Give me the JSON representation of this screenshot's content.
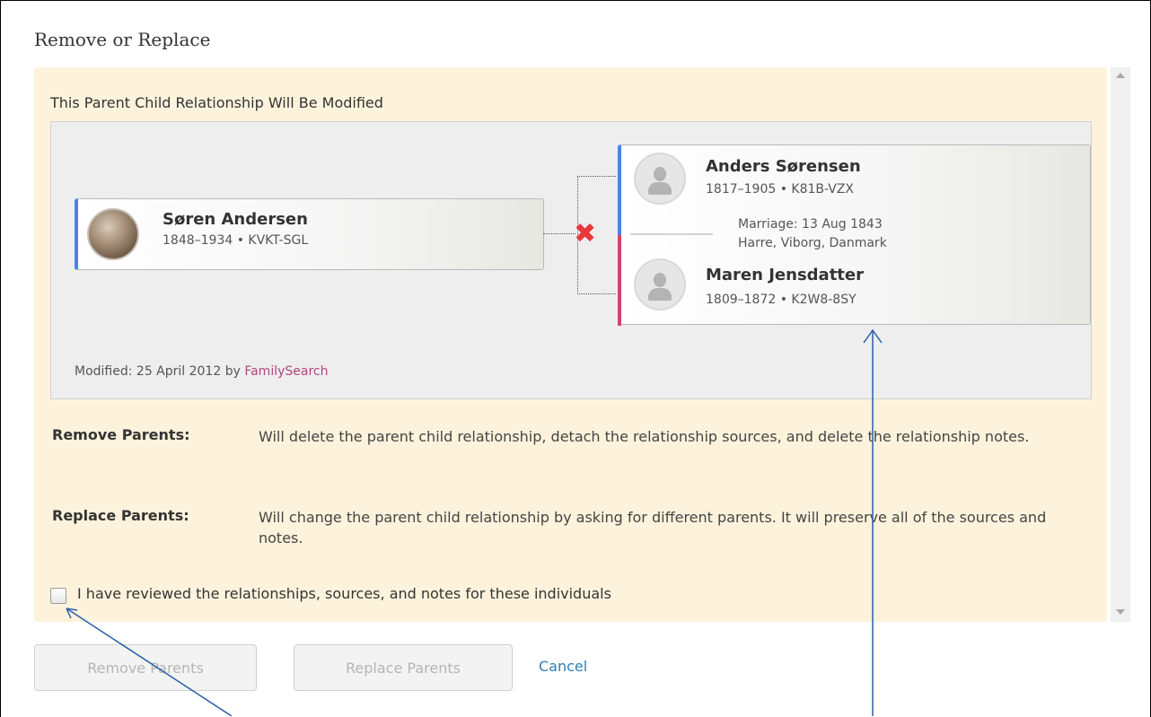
{
  "dialog": {
    "title": "Remove or Replace"
  },
  "panel": {
    "title": "This Parent Child Relationship Will Be Modified",
    "child": {
      "name": "Søren Andersen",
      "meta": "1848–1934 • KVKT-SGL"
    },
    "father": {
      "name": "Anders Sørensen",
      "meta": "1817–1905 • K81B-VZX"
    },
    "mother": {
      "name": "Maren Jensdatter",
      "meta": "1809–1872 • K2W8-8SY"
    },
    "marriage": {
      "line1": "Marriage: 13 Aug 1843",
      "line2": "Harre, Viborg, Danmark"
    },
    "modified": {
      "prefix": "Modified: 25 April 2012  by ",
      "by_link": "FamilySearch"
    },
    "remove": {
      "label": "Remove Parents:",
      "text": "Will delete the parent child relationship, detach the relationship sources, and delete the relationship notes."
    },
    "replace": {
      "label": "Replace Parents:",
      "text": "Will change the parent child relationship by asking for different parents. It will preserve all of the sources and notes."
    },
    "checkbox": {
      "label": "I have reviewed the relationships, sources, and notes for these individuals",
      "checked": false
    }
  },
  "buttons": {
    "remove": "Remove Parents",
    "replace": "Replace Parents",
    "cancel": "Cancel"
  },
  "icons": {
    "remove_mark": "x-mark-icon",
    "placeholder": "person-silhouette-icon"
  },
  "colors": {
    "male_bar": "#4a84e8",
    "female_bar": "#d4456e",
    "x_mark": "#e8383b",
    "link": "#2f7fb8",
    "panel_bg": "#fdf3dc",
    "annotation": "#2a5fa8"
  }
}
